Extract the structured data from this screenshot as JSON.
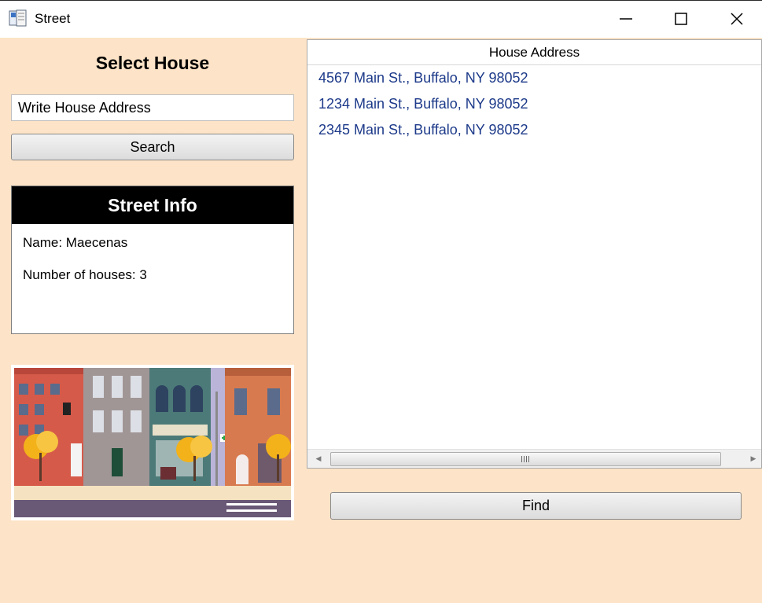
{
  "window": {
    "title": "Street",
    "controls": [
      "minimize-icon",
      "maximize-icon",
      "close-icon"
    ]
  },
  "left_panel": {
    "heading": "Select House",
    "search_input": {
      "value": "Write House Address",
      "placeholder": ""
    },
    "search_button": "Search",
    "street_info": {
      "title": "Street Info",
      "name_line": "Name: Maecenas",
      "count_line": "Number of houses: 3"
    },
    "street_image": "street-illustration"
  },
  "list_panel": {
    "column_header": "House Address",
    "items": [
      "4567 Main St., Buffalo, NY 98052",
      "1234 Main St., Buffalo, NY 98052",
      "2345 Main St., Buffalo, NY 98052"
    ],
    "find_button": "Find"
  },
  "colors": {
    "window_background": "#fde3c7",
    "info_header": "#000000",
    "list_text": "#1d3a8a"
  }
}
